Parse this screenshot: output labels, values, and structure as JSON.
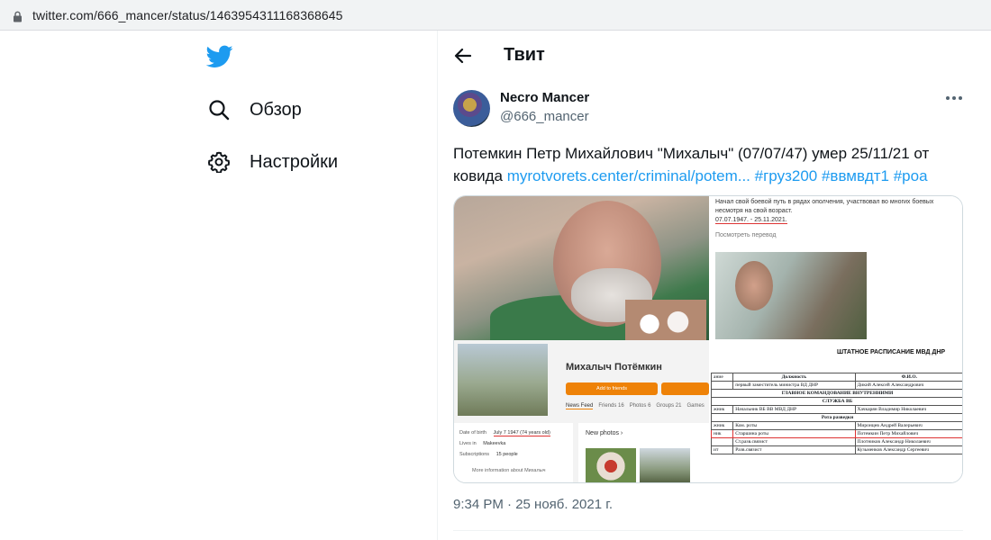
{
  "browser": {
    "url": "twitter.com/666_mancer/status/1463954311168368645"
  },
  "nav": {
    "items": [
      {
        "label": "Обзор",
        "icon": "search-icon"
      },
      {
        "label": "Настройки",
        "icon": "gear-icon"
      }
    ]
  },
  "header": {
    "title": "Твит"
  },
  "tweet": {
    "author_name": "Necro Mancer",
    "author_handle": "@666_mancer",
    "text_plain": "Потемкин Петр Михайлович \"Михалыч\" (07/07/47) умер 25/11/21 от ковида",
    "link_text": "myrotvorets.center/criminal/potem...",
    "hashtags": [
      "#груз200",
      "#ввмвдт1",
      "#роа"
    ],
    "timestamp": "9:34 PM · 25 нояб. 2021 г."
  },
  "media": {
    "doc": {
      "line1": "Начал свой боевой путь в рядах ополчения, участвовал во многих боевых",
      "line2": "несмотря на свой возраст.",
      "dates": "07.07.1947. - 25.11.2021.",
      "translate": "Посмотреть перевод",
      "title": "ШТАТНОЕ РАСПИСАНИЕ МВД ДНР",
      "table_header": [
        "ание",
        "Должность",
        "Ф.И.О."
      ],
      "rows": [
        [
          "",
          "первый заместитель министра ВД ДНР",
          "Дикий Алексей Александрович"
        ],
        [
          "",
          "ГЛАВНОЕ КОМАНДОВАНИЕ ВНУТРЕННИМИ",
          ""
        ],
        [
          "",
          "СЛУЖБА ВБ",
          ""
        ],
        [
          "жник",
          "Начальник ВБ ВВ МВД ДНР",
          "Хачкарян Владимир Николаевич"
        ],
        [
          "",
          "Рота разведки",
          ""
        ],
        [
          "жник",
          "Ком. роты",
          "Миронцев Андрей Валерьевич"
        ],
        [
          "ник",
          "Старшина роты",
          "Потемкин Петр Михайлович"
        ],
        [
          "",
          "Ст.разв.связист",
          "Плотников Александр Николаевич"
        ],
        [
          "ит",
          "Разв.связист",
          "Кузьменков Александр Сергеевич"
        ]
      ]
    },
    "profile": {
      "name": "Михалыч Потёмкин",
      "add_friends": "Add to friends",
      "tabs": [
        "News Feed",
        "Friends 16",
        "Photos 6",
        "Groups 21",
        "Games"
      ],
      "info": [
        {
          "label": "Date of birth",
          "value": "July 7 1947 (74 years old)"
        },
        {
          "label": "Lives in",
          "value": "Makeevka"
        },
        {
          "label": "Subscriptions",
          "value": "15 people"
        }
      ],
      "more_info": "More information about Михалыч",
      "new_photos": "New photos ›"
    }
  },
  "colors": {
    "accent": "#1d9bf0",
    "text": "#0f1419",
    "muted": "#536471",
    "ok_orange": "#ee8208"
  }
}
